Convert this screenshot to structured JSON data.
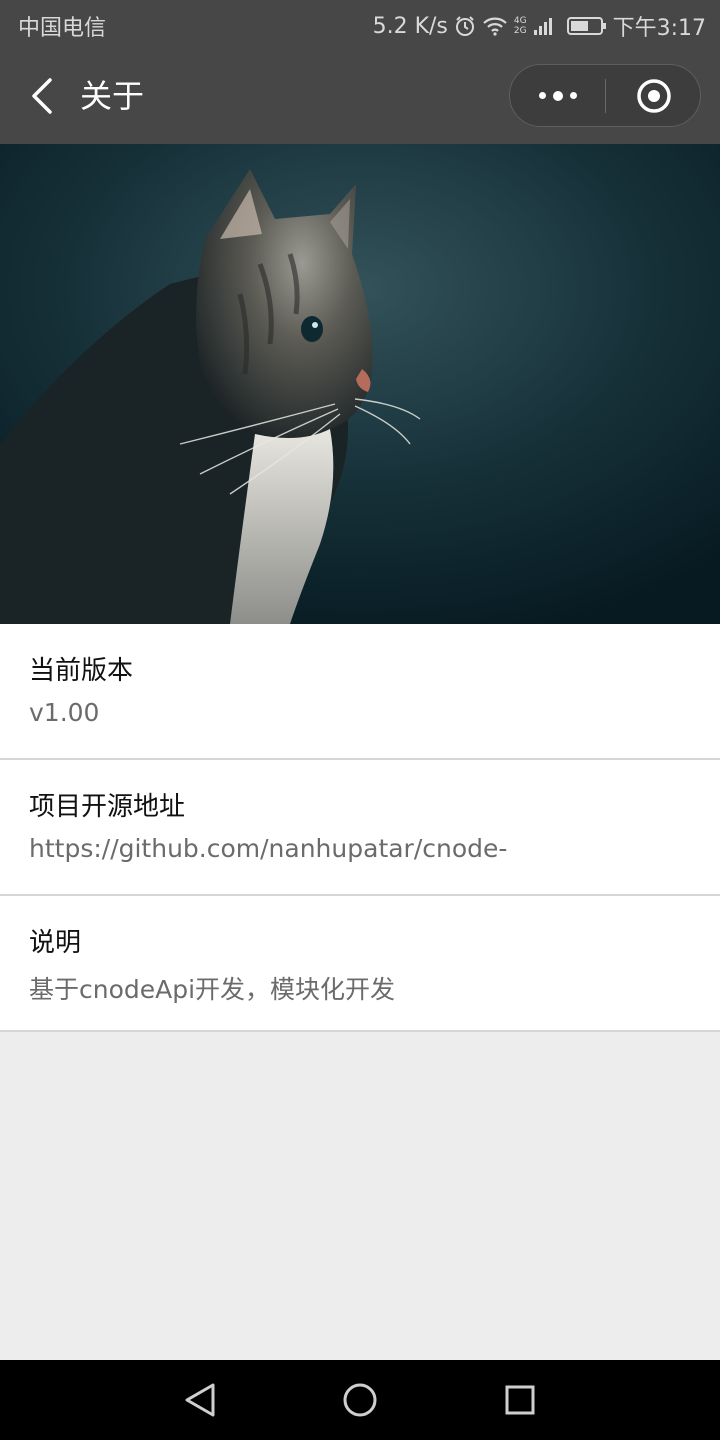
{
  "status_bar": {
    "carrier": "中国电信",
    "speed": "5.2 K/s",
    "network": [
      "4G",
      "2G"
    ],
    "time": "下午3:17",
    "icons": [
      "alarm-icon",
      "wifi-icon",
      "signal-icon",
      "battery-icon"
    ]
  },
  "nav": {
    "title": "关于",
    "back_icon": "back-chevron-icon",
    "more_icon": "more-dots-icon",
    "close_icon": "target-circle-icon"
  },
  "hero": {
    "alt": "cat-photo"
  },
  "items": [
    {
      "label": "当前版本",
      "value": "v1.00"
    },
    {
      "label": "项目开源地址",
      "value": "https://github.com/nanhupatar/cnode-"
    },
    {
      "label": "说明",
      "value": "基于cnodeApi开发，模块化开发"
    }
  ],
  "colors": {
    "bar": "#474747",
    "page_bg": "#ededed",
    "divider": "#d6d6d6"
  }
}
